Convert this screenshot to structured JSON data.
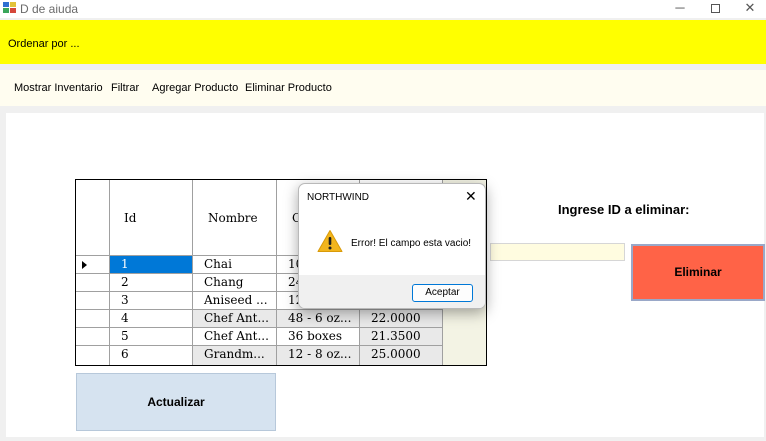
{
  "window": {
    "title": "D de aiuda",
    "minimize": "─",
    "close": "✕",
    "icon": "windows-app-icon"
  },
  "strip": {
    "label": "Ordenar por ..."
  },
  "menu": [
    {
      "label": "Mostrar Inventario"
    },
    {
      "label": "Filtrar"
    },
    {
      "label": "Agregar Producto"
    },
    {
      "label": "Eliminar Producto"
    }
  ],
  "grid": {
    "headers": {
      "id": "Id",
      "nombre": "Nombre",
      "cantidad": "C"
    },
    "rows": [
      {
        "id": "1",
        "nombre": "Chai",
        "cantidad": "10",
        "precio": ""
      },
      {
        "id": "2",
        "nombre": "Chang",
        "cantidad": "24",
        "precio": ""
      },
      {
        "id": "3",
        "nombre": "Aniseed ...",
        "cantidad": "12",
        "precio": ""
      },
      {
        "id": "4",
        "nombre": "Chef Ant...",
        "cantidad": "48 - 6 oz...",
        "precio": "22.0000"
      },
      {
        "id": "5",
        "nombre": "Chef Ant...",
        "cantidad": "36 boxes",
        "precio": "21.3500"
      },
      {
        "id": "6",
        "nombre": "Grandm...",
        "cantidad": "12 - 8 oz...",
        "precio": "25.0000"
      }
    ],
    "selected_row": "1"
  },
  "delete_panel": {
    "label": "Ingrese ID a eliminar:",
    "input_value": "",
    "button_label": "Eliminar"
  },
  "actualizar": {
    "label": "Actualizar"
  },
  "dialog": {
    "title": "NORTHWIND",
    "close": "✕",
    "icon": "warning-icon",
    "message": "Error! El campo esta vacio!",
    "ok_label": "Aceptar"
  },
  "colors": {
    "strip": "#ffff00",
    "eliminar_button": "#ff6347",
    "actualizar_button": "#d6e3f0",
    "selection": "#0078d7"
  }
}
